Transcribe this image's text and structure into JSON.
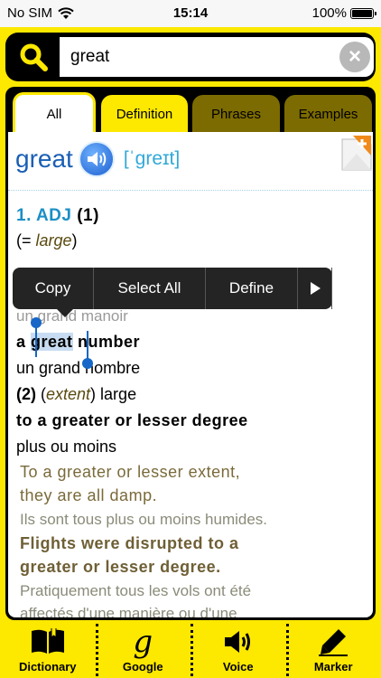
{
  "status": {
    "carrier": "No SIM",
    "time": "15:14",
    "battery": "100%"
  },
  "search": {
    "value": "great",
    "clear_icon": "close-circle-icon",
    "search_icon": "search-icon"
  },
  "tabs": [
    {
      "label": "All",
      "active": true
    },
    {
      "label": "Definition",
      "active": false
    },
    {
      "label": "Phrases",
      "active": false
    },
    {
      "label": "Examples",
      "active": false
    }
  ],
  "entry": {
    "headword": "great",
    "phonetic": "[ˈɡreɪt]",
    "sense_number": "1.",
    "sense_pos": "ADJ",
    "sense_sub1": "(1)",
    "eq_open": "(= ",
    "eq_word": "large",
    "eq_close": ")",
    "partial_hidden": "un grand manoir",
    "phrase1_pre": "a ",
    "phrase1_sel": "great",
    "phrase1_post": " number",
    "trans1": "un grand nombre",
    "sense2_num": "(2)",
    "sense2_paren_open": " (",
    "sense2_it": "extent",
    "sense2_paren_close": ")",
    "sense2_word": " large",
    "phrase2": "to a greater or lesser degree",
    "trans2": "plus ou moins",
    "ex1_line1": "To a greater or lesser extent,",
    "ex1_line2": "they are all damp.",
    "ex1_trans": "Ils sont tous plus ou moins humides.",
    "ex2_line1": "Flights were disrupted to a",
    "ex2_line2": "greater or lesser degree.",
    "ex2_trans1": "Pratiquement tous les vols ont été",
    "ex2_trans2": "affectés d'une manière ou d'une"
  },
  "context_menu": {
    "items": [
      "Copy",
      "Select All",
      "Define"
    ],
    "more_icon": "play-right-icon"
  },
  "toolbar": {
    "items": [
      {
        "label": "Dictionary",
        "icon": "book-icon"
      },
      {
        "label": "Google",
        "icon": "google-g-icon"
      },
      {
        "label": "Voice",
        "icon": "speaker-icon"
      },
      {
        "label": "Marker",
        "icon": "marker-icon"
      }
    ]
  },
  "colors": {
    "accent_yellow": "#fde800",
    "tab_olive": "#7c6b00",
    "headword_blue": "#1a5fb4",
    "phonetic_cyan": "#31a8d8",
    "selection": "#c7dcf2"
  }
}
